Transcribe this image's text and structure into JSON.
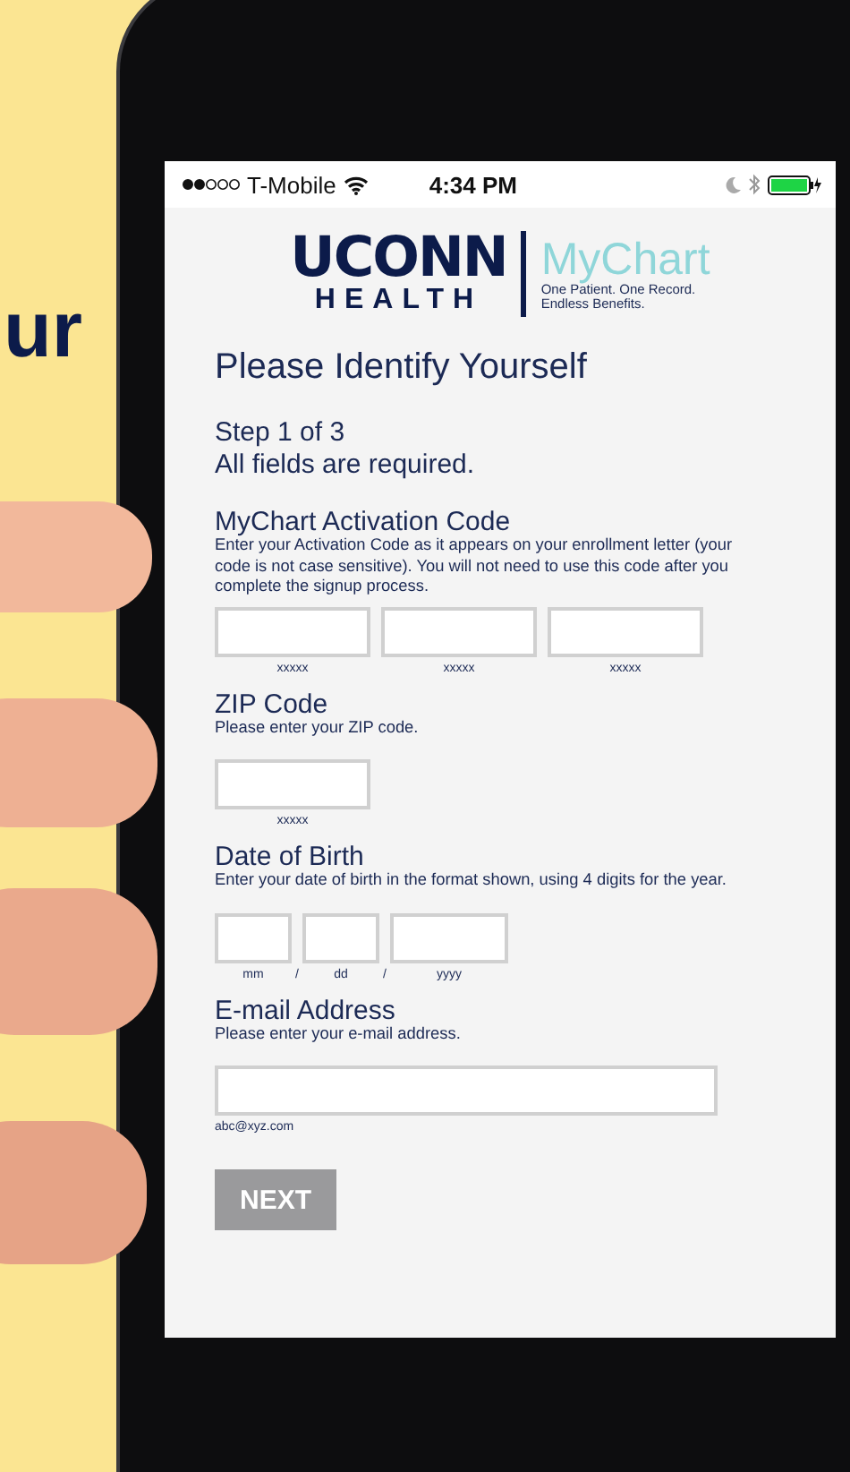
{
  "backdrop_text": "ur",
  "status_bar": {
    "carrier": "T-Mobile",
    "time": "4:34 PM"
  },
  "logo": {
    "wordmark": "UCONN",
    "subline": "HEALTH",
    "product": "MyChart",
    "tagline": [
      "One Patient. One Record.",
      "Endless Benefits."
    ]
  },
  "title": "Please Identify Yourself",
  "step": "Step 1 of 3",
  "note": "All fields are required.",
  "sections": [
    {
      "title": "MyChart Activation Code",
      "help": "Enter your Activation Code as it appears on your enrollment letter (your code is not case sensitive). You will not need to use this code after you complete the signup process.",
      "fields": [
        {
          "kind": "code",
          "caption": "xxxxx"
        },
        {
          "kind": "code",
          "caption": "xxxxx"
        },
        {
          "kind": "code",
          "caption": "xxxxx"
        }
      ]
    },
    {
      "title": "ZIP Code",
      "help": "Please enter your ZIP code.",
      "fields": [
        {
          "kind": "code",
          "caption": "xxxxx"
        }
      ]
    },
    {
      "title": "Date of Birth",
      "help": "Enter your date of birth in the format shown, using 4 digits for the year.",
      "fields": [
        {
          "kind": "short",
          "caption": "mm"
        },
        {
          "kind": "short",
          "caption": "dd"
        },
        {
          "kind": "year",
          "caption": "yyyy"
        }
      ],
      "separators": [
        "/",
        "/"
      ]
    },
    {
      "title": "E-mail Address",
      "help": "Please enter your e-mail address.",
      "fields": [
        {
          "kind": "email",
          "caption": "abc@xyz.com"
        }
      ]
    }
  ],
  "next_button": {
    "label": "NEXT",
    "disabled": true
  }
}
